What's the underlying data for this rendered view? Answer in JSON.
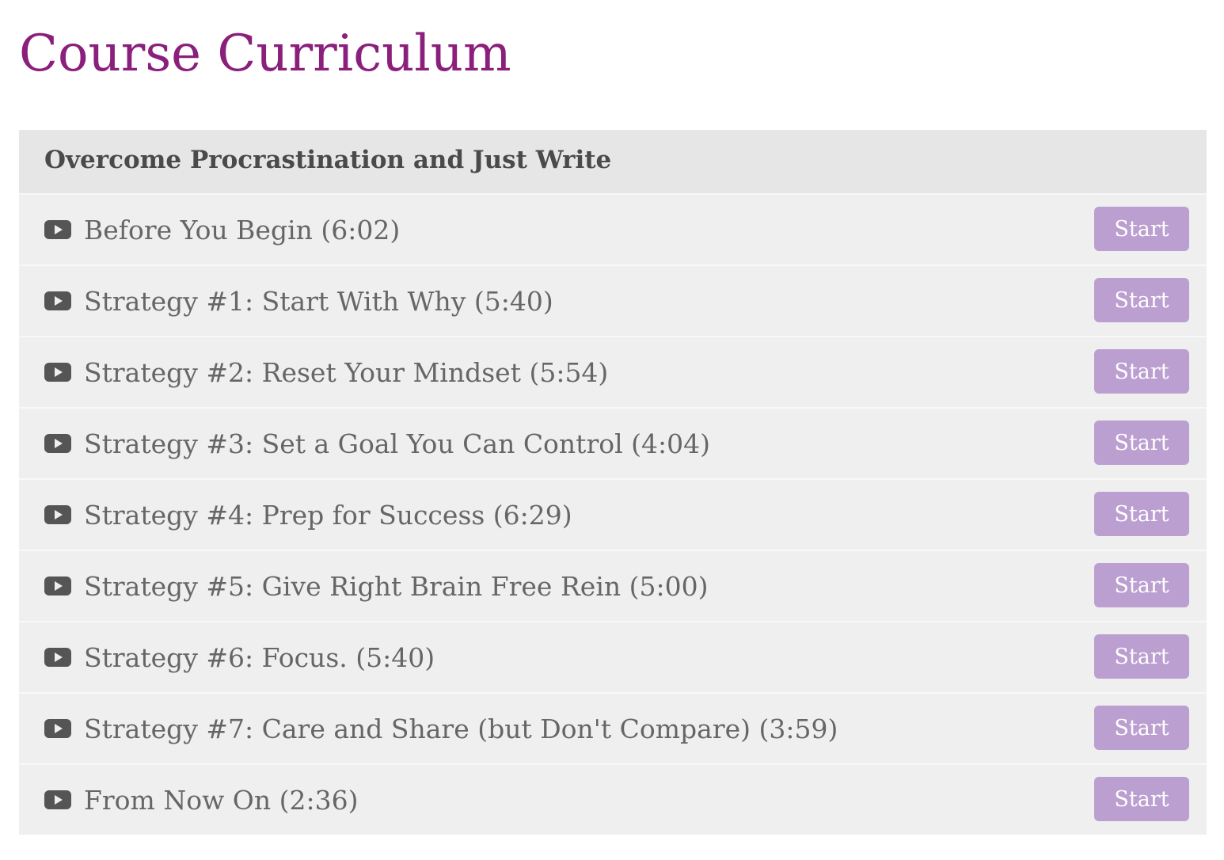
{
  "page": {
    "title": "Course Curriculum"
  },
  "section": {
    "title": "Overcome Procrastination and Just Write",
    "lectures": [
      {
        "name": "Before You Begin (6:02)",
        "button_label": "Start"
      },
      {
        "name": "Strategy #1: Start With Why (5:40)",
        "button_label": "Start"
      },
      {
        "name": "Strategy #2: Reset Your Mindset (5:54)",
        "button_label": "Start"
      },
      {
        "name": "Strategy #3: Set a Goal You Can Control (4:04)",
        "button_label": "Start"
      },
      {
        "name": "Strategy #4: Prep for Success (6:29)",
        "button_label": "Start"
      },
      {
        "name": "Strategy #5: Give Right Brain Free Rein (5:00)",
        "button_label": "Start"
      },
      {
        "name": "Strategy #6: Focus. (5:40)",
        "button_label": "Start"
      },
      {
        "name": "Strategy #7: Care and Share (but Don't Compare) (3:59)",
        "button_label": "Start"
      },
      {
        "name": "From Now On (2:36)",
        "button_label": "Start"
      }
    ]
  },
  "icons": {
    "lecture_icon": "video-play-icon"
  },
  "colors": {
    "title": "#8a1f7c",
    "section_header_bg": "#e6e6e6",
    "row_bg": "#efefef",
    "start_button_bg": "#bb9fd0",
    "start_button_text": "#ffffff",
    "text": "#666666",
    "icon": "#555555"
  }
}
